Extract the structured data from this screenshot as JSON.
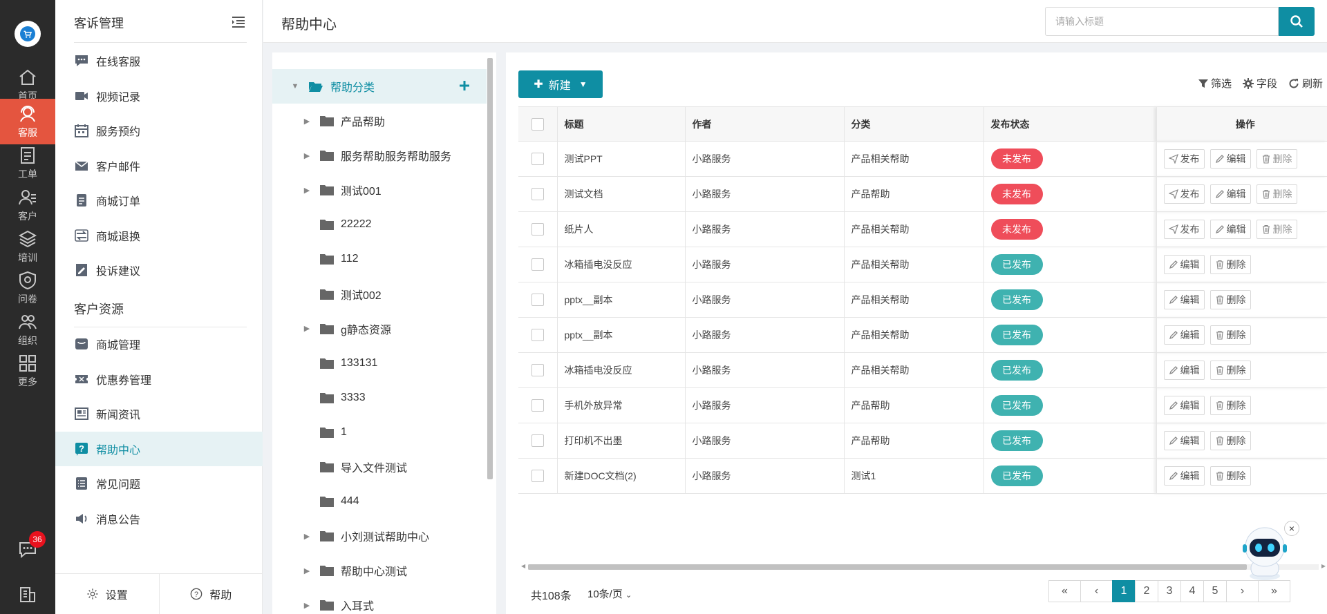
{
  "rail": {
    "items": [
      {
        "label": "首页",
        "icon": "home-icon"
      },
      {
        "label": "客服",
        "icon": "headset-icon"
      },
      {
        "label": "工单",
        "icon": "clipboard-icon"
      },
      {
        "label": "客户",
        "icon": "user-icon"
      },
      {
        "label": "培训",
        "icon": "layers-icon"
      },
      {
        "label": "问卷",
        "icon": "shield-icon"
      },
      {
        "label": "组织",
        "icon": "group-icon"
      },
      {
        "label": "更多",
        "icon": "grid-icon"
      }
    ],
    "active_index": 1,
    "message_badge": "36",
    "accent": "#e4553f"
  },
  "sidebar": {
    "section1_title": "客诉管理",
    "section1_items": [
      {
        "label": "在线客服",
        "icon": "chat-icon"
      },
      {
        "label": "视频记录",
        "icon": "video-icon"
      },
      {
        "label": "服务预约",
        "icon": "calendar-icon"
      },
      {
        "label": "客户邮件",
        "icon": "mail-icon"
      },
      {
        "label": "商城订单",
        "icon": "order-icon"
      },
      {
        "label": "商城退换",
        "icon": "return-icon"
      },
      {
        "label": "投诉建议",
        "icon": "edit-doc-icon"
      }
    ],
    "section2_title": "客户资源",
    "section2_items": [
      {
        "label": "商城管理",
        "icon": "shop-icon"
      },
      {
        "label": "优惠券管理",
        "icon": "coupon-icon"
      },
      {
        "label": "新闻资讯",
        "icon": "news-icon"
      },
      {
        "label": "帮助中心",
        "icon": "help-icon"
      },
      {
        "label": "常见问题",
        "icon": "list-icon"
      },
      {
        "label": "消息公告",
        "icon": "speaker-icon"
      }
    ],
    "active_item": "帮助中心",
    "footer": {
      "settings": "设置",
      "help": "帮助"
    }
  },
  "header": {
    "title": "帮助中心",
    "search_placeholder": "请输入标题"
  },
  "tree": {
    "root": "帮助分类",
    "nodes": [
      {
        "label": "产品帮助",
        "expandable": true
      },
      {
        "label": "服务帮助服务帮助服务",
        "expandable": true
      },
      {
        "label": "测试001",
        "expandable": true
      },
      {
        "label": "22222",
        "expandable": false
      },
      {
        "label": "112",
        "expandable": false
      },
      {
        "label": "测试002",
        "expandable": false
      },
      {
        "label": "g静态资源",
        "expandable": true
      },
      {
        "label": "133131",
        "expandable": false
      },
      {
        "label": "3333",
        "expandable": false
      },
      {
        "label": "1",
        "expandable": false
      },
      {
        "label": "导入文件测试",
        "expandable": false
      },
      {
        "label": "444",
        "expandable": false
      },
      {
        "label": "小刘测试帮助中心",
        "expandable": true
      },
      {
        "label": "帮助中心测试",
        "expandable": true
      },
      {
        "label": "入耳式",
        "expandable": true
      }
    ]
  },
  "toolbar": {
    "new_label": "新建",
    "filter": "筛选",
    "fields": "字段",
    "refresh": "刷新"
  },
  "table": {
    "columns": [
      "标题",
      "作者",
      "分类",
      "发布状态",
      "操作"
    ],
    "rows": [
      {
        "title": "测试PPT",
        "author": "小路服务",
        "category": "产品相关帮助",
        "status": "未发布",
        "published": false
      },
      {
        "title": "测试文档",
        "author": "小路服务",
        "category": "产品帮助",
        "status": "未发布",
        "published": false
      },
      {
        "title": "纸片人",
        "author": "小路服务",
        "category": "产品相关帮助",
        "status": "未发布",
        "published": false
      },
      {
        "title": "冰箱插电没反应",
        "author": "小路服务",
        "category": "产品相关帮助",
        "status": "已发布",
        "published": true
      },
      {
        "title": "pptx__副本",
        "author": "小路服务",
        "category": "产品相关帮助",
        "status": "已发布",
        "published": true
      },
      {
        "title": "pptx__副本",
        "author": "小路服务",
        "category": "产品相关帮助",
        "status": "已发布",
        "published": true
      },
      {
        "title": "冰箱插电没反应",
        "author": "小路服务",
        "category": "产品相关帮助",
        "status": "已发布",
        "published": true
      },
      {
        "title": "手机外放异常",
        "author": "小路服务",
        "category": "产品帮助",
        "status": "已发布",
        "published": true
      },
      {
        "title": "打印机不出墨",
        "author": "小路服务",
        "category": "产品帮助",
        "status": "已发布",
        "published": true
      },
      {
        "title": "新建DOC文档(2)",
        "author": "小路服务",
        "category": "测试1",
        "status": "已发布",
        "published": true
      }
    ],
    "op_publish": "发布",
    "op_edit": "编辑",
    "op_delete": "删除"
  },
  "pagination": {
    "total": "共108条",
    "page_size": "10条/页",
    "pages": [
      "1",
      "2",
      "3",
      "4",
      "5"
    ],
    "current": "1"
  },
  "colors": {
    "primary": "#0f8ea3",
    "unpublished": "#ef4d5a",
    "published": "#3fb2b0"
  }
}
